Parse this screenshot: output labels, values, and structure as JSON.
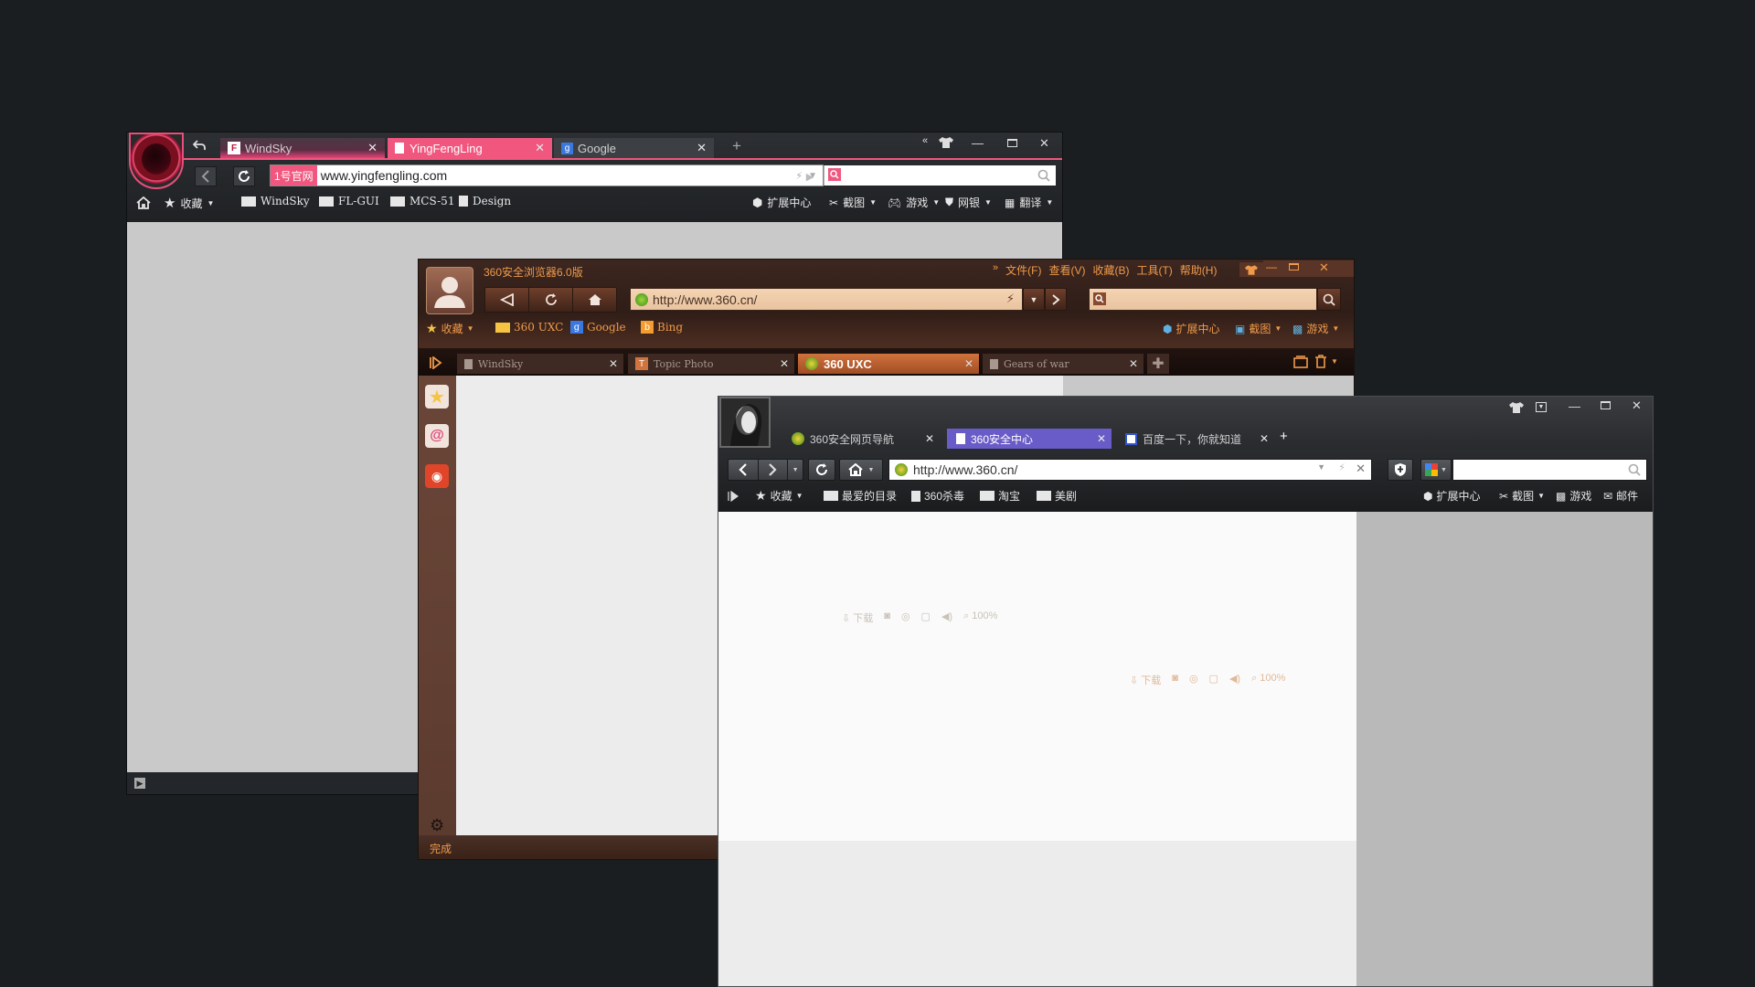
{
  "win1": {
    "tabs": [
      {
        "label": "WindSky"
      },
      {
        "label": "YingFengLing"
      },
      {
        "label": "Google"
      }
    ],
    "address": {
      "badge": "1号官网",
      "url": "www.yingfengling.com"
    },
    "bookmarks": [
      {
        "label": "收藏"
      },
      {
        "label": "WindSky"
      },
      {
        "label": "FL-GUI"
      },
      {
        "label": "MCS-51"
      },
      {
        "label": "Design"
      }
    ],
    "tools": [
      {
        "label": "扩展中心"
      },
      {
        "label": "截图"
      },
      {
        "label": "游戏"
      },
      {
        "label": "网银"
      },
      {
        "label": "翻译"
      }
    ],
    "colors": {
      "accent": "#f0567e"
    }
  },
  "win2": {
    "title": "360安全浏览器6.0版",
    "menu": [
      "文件(F)",
      "查看(V)",
      "收藏(B)",
      "工具(T)",
      "帮助(H)"
    ],
    "address": {
      "url": "http://www.360.cn/"
    },
    "bookmarks": [
      {
        "label": "收藏"
      },
      {
        "label": "360 UXC"
      },
      {
        "label": "Google"
      },
      {
        "label": "Bing"
      }
    ],
    "tools": [
      {
        "label": "扩展中心"
      },
      {
        "label": "截图"
      },
      {
        "label": "游戏"
      }
    ],
    "tabs": [
      {
        "label": "WindSky"
      },
      {
        "label": "Topic Photo"
      },
      {
        "label": "360 UXC"
      },
      {
        "label": "Gears of war"
      }
    ],
    "status": {
      "text": "完成"
    },
    "colors": {
      "accent": "#ef9a4a",
      "tab_active": "#c5642f"
    }
  },
  "win3": {
    "tabs": [
      {
        "label": "360安全网页导航"
      },
      {
        "label": "360安全中心"
      },
      {
        "label": "百度一下，你就知道"
      }
    ],
    "address": {
      "url": "http://www.360.cn/"
    },
    "bookmarks": [
      {
        "label": "收藏"
      },
      {
        "label": "最爱的目录"
      },
      {
        "label": "360杀毒"
      },
      {
        "label": "淘宝"
      },
      {
        "label": "美剧"
      }
    ],
    "tools": [
      {
        "label": "扩展中心"
      },
      {
        "label": "截图"
      },
      {
        "label": "游戏"
      },
      {
        "label": "邮件"
      }
    ],
    "colors": {
      "tab_active": "#6a5cc8"
    }
  },
  "ghost_status": {
    "download": "下载",
    "zoom": "100%"
  }
}
